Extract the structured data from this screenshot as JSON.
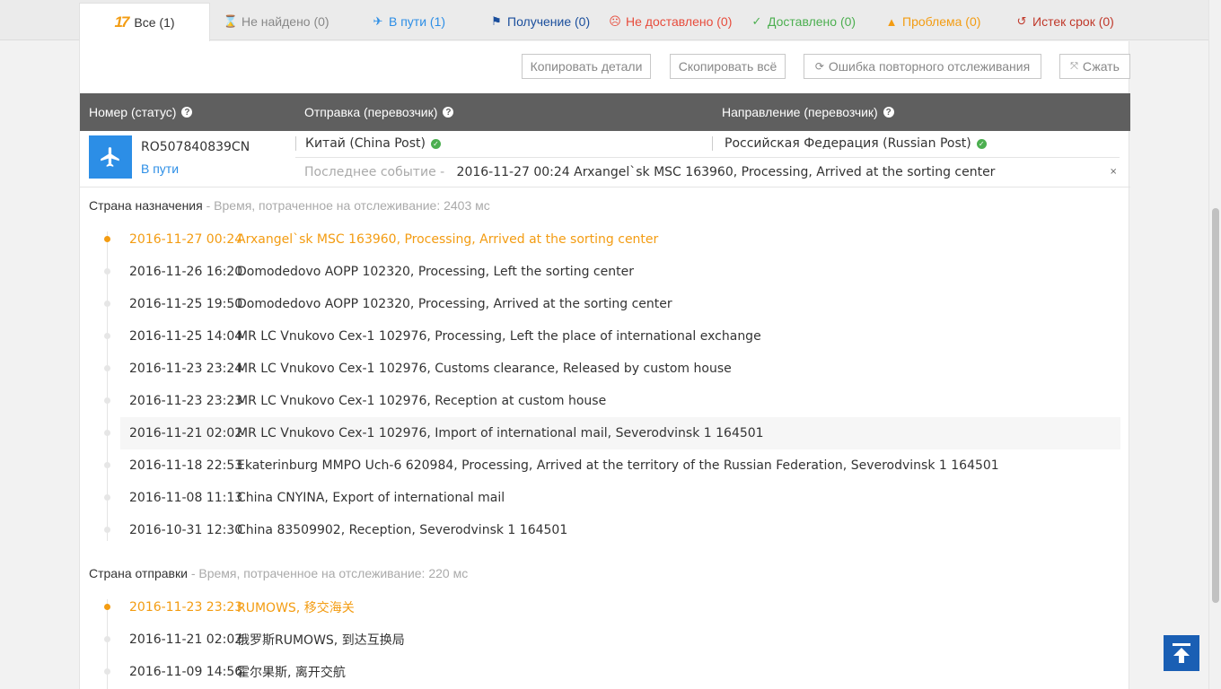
{
  "tabs": [
    {
      "label": "Все (1)",
      "color": "#333333",
      "icon": "17track-logo"
    },
    {
      "label": "Не найдено (0)",
      "color": "#888888",
      "icon": "hourglass-icon"
    },
    {
      "label": "В пути (1)",
      "color": "#2c8ee6",
      "icon": "plane-icon"
    },
    {
      "label": "Получение (0)",
      "color": "#1a4e9c",
      "icon": "flag-icon"
    },
    {
      "label": "Не доставлено (0)",
      "color": "#e74c3c",
      "icon": "sad-face-icon"
    },
    {
      "label": "Доставлено (0)",
      "color": "#4caf50",
      "icon": "check-icon"
    },
    {
      "label": "Проблема (0)",
      "color": "#f39c12",
      "icon": "warning-icon"
    },
    {
      "label": "Истек срок (0)",
      "color": "#c0392b",
      "icon": "history-icon"
    }
  ],
  "logo": "17",
  "toolbar": {
    "copy_details": "Копировать детали",
    "copy_all": "Скопировать всё",
    "retrack_error": "Ошибка повторного отслеживания",
    "collapse": "Сжать"
  },
  "table": {
    "col_number": "Номер (статус)",
    "col_origin": "Отправка (перевозчик)",
    "col_dest": "Направление (перевозчик)"
  },
  "shipment": {
    "number": "RO507840839CN",
    "status": "В пути",
    "origin_carrier": "Китай (China Post)",
    "dest_carrier": "Российская Федерация (Russian Post)",
    "last_event_label": "Последнее событие -",
    "last_event": "2016-11-27 00:24 Arxangel`sk MSC 163960, Processing, Arrived at the sorting center"
  },
  "destination": {
    "title": "Страна назначения",
    "subtitle": " - Время, потраченное на отслеживание: 2403 мс",
    "events": [
      {
        "date": "2016-11-27 00:24",
        "text": "Arxangel`sk MSC 163960, Processing, Arrived at the sorting center"
      },
      {
        "date": "2016-11-26 16:20",
        "text": "Domodedovo AOPP 102320, Processing, Left the sorting center"
      },
      {
        "date": "2016-11-25 19:50",
        "text": "Domodedovo AOPP 102320, Processing, Arrived at the sorting center"
      },
      {
        "date": "2016-11-25 14:04",
        "text": "MR LC Vnukovo Cex-1 102976, Processing, Left the place of international exchange"
      },
      {
        "date": "2016-11-23 23:24",
        "text": "MR LC Vnukovo Cex-1 102976, Customs clearance, Released by custom house"
      },
      {
        "date": "2016-11-23 23:23",
        "text": "MR LC Vnukovo Cex-1 102976, Reception at custom house"
      },
      {
        "date": "2016-11-21 02:02",
        "text": "MR LC Vnukovo Cex-1 102976, Import of international mail, Severodvinsk 1 164501"
      },
      {
        "date": "2016-11-18 22:53",
        "text": "Ekaterinburg MMPO Uch-6 620984, Processing, Arrived at the territory of the Russian Federation, Severodvinsk 1 164501"
      },
      {
        "date": "2016-11-08 11:13",
        "text": "China CNYINA, Export of international mail"
      },
      {
        "date": "2016-10-31 12:30",
        "text": "China 83509902, Reception, Severodvinsk 1 164501"
      }
    ]
  },
  "origin": {
    "title": "Страна отправки",
    "subtitle": " - Время, потраченное на отслеживание: 220 мс",
    "events": [
      {
        "date": "2016-11-23 23:23",
        "text": "RUMOWS, 移交海关"
      },
      {
        "date": "2016-11-21 02:02",
        "text": "俄罗斯RUMOWS, 到达互换局"
      },
      {
        "date": "2016-11-09 14:56",
        "text": "霍尔果斯, 离开交航"
      }
    ]
  },
  "colors": {
    "accent": "#2c8ee6",
    "latest": "#f39c12",
    "header": "#5f5f5f"
  }
}
